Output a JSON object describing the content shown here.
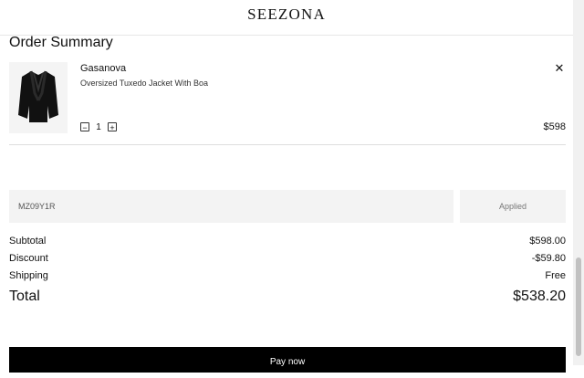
{
  "header": {
    "logo": "SEEZONA"
  },
  "order": {
    "title": "Order Summary",
    "item": {
      "brand": "Gasanova",
      "name": "Oversized Tuxedo Jacket With Boa",
      "quantity": "1",
      "price": "$598",
      "minus": "−",
      "plus": "+",
      "remove": "✕"
    }
  },
  "promo": {
    "code": "MZ09Y1R",
    "button": "Applied"
  },
  "summary": {
    "subtotal_label": "Subtotal",
    "subtotal_value": "$598.00",
    "discount_label": "Discount",
    "discount_value": "-$59.80",
    "shipping_label": "Shipping",
    "shipping_value": "Free",
    "total_label": "Total",
    "total_value": "$538.20"
  },
  "pay": {
    "label": "Pay now"
  }
}
